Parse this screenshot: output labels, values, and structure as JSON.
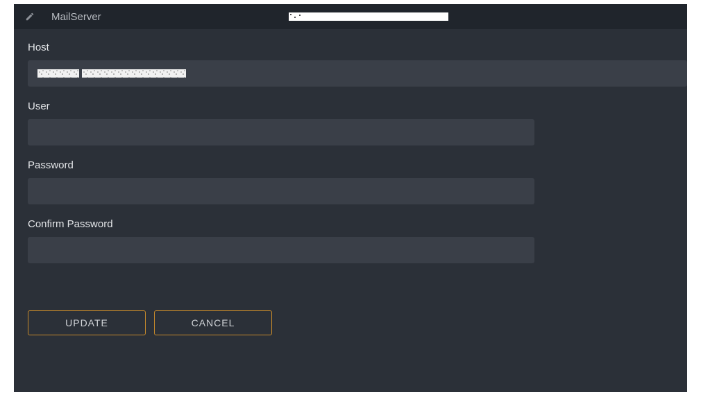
{
  "header": {
    "title": "MailServer",
    "subtitle_redacted": true
  },
  "fields": {
    "host": {
      "label": "Host",
      "value_redacted": true,
      "value": ""
    },
    "user": {
      "label": "User",
      "value": ""
    },
    "password": {
      "label": "Password",
      "value": ""
    },
    "confirm_password": {
      "label": "Confirm Password",
      "value": ""
    }
  },
  "buttons": {
    "update": "UPDATE",
    "cancel": "CANCEL"
  },
  "colors": {
    "panel_bg": "#2b3038",
    "header_bg": "#20252c",
    "input_bg": "#3a3f48",
    "accent": "#c98b2b",
    "text": "#e3e5e8"
  }
}
